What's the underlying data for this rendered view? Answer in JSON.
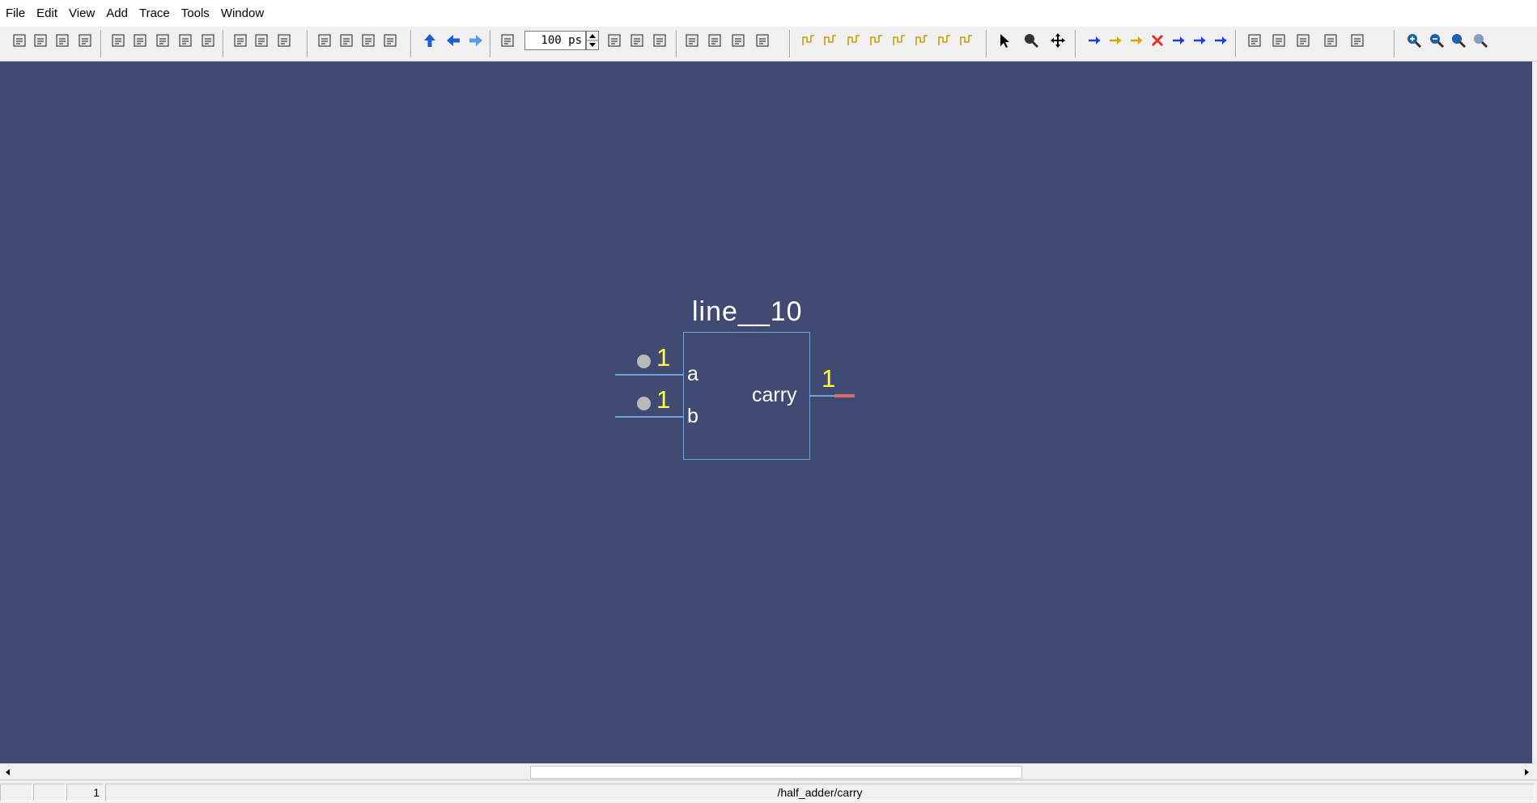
{
  "menu": [
    "File",
    "Edit",
    "View",
    "Add",
    "Trace",
    "Tools",
    "Window"
  ],
  "toolbar": {
    "time_value": "100 ps",
    "icons": [
      "new-icon",
      "open-icon",
      "save-icon",
      "print-icon",
      "cut-icon",
      "copy-icon",
      "paste-icon",
      "undo-icon",
      "redo-icon",
      "find-icon",
      "find-replace-icon",
      "goto-icon",
      "restart-icon",
      "run-all-icon",
      "run-icon",
      "stop-icon",
      "up-icon",
      "back-icon",
      "forward-icon",
      "step-icon",
      "step-in-icon",
      "step-over-icon",
      "step-out-icon",
      "continue-icon",
      "break-icon",
      "wave-icon",
      "wave-alt-icon",
      "trace-1-icon",
      "trace-2-icon",
      "trace-3-icon",
      "trace-4-icon",
      "trace-5-icon",
      "trace-6-icon",
      "trace-7-icon",
      "trace-8-icon",
      "select-icon",
      "zoom-region-icon",
      "pan-icon",
      "signal-first-icon",
      "signal-prev-icon",
      "signal-next-icon",
      "signal-delete-icon",
      "signal-in-icon",
      "signal-both-icon",
      "signal-out-icon",
      "edit-1-icon",
      "edit-2-icon",
      "edit-3-icon",
      "driver-icon",
      "chip-icon",
      "zoom-in-icon",
      "zoom-out-icon",
      "zoom-full-icon",
      "zoom-fit-icon"
    ]
  },
  "schematic": {
    "instance_label": "line__10",
    "inputs": [
      {
        "name": "a",
        "value": "1"
      },
      {
        "name": "b",
        "value": "1"
      }
    ],
    "output": {
      "name": "carry",
      "value": "1"
    },
    "colors": {
      "background": "#414a72",
      "wire": "#6fa3d8",
      "value": "#ffff3c",
      "driver_dot": "#b9b9b9",
      "active_output": "#e06a6a"
    }
  },
  "status": {
    "cell_value": "1",
    "path": "/half_adder/carry"
  }
}
